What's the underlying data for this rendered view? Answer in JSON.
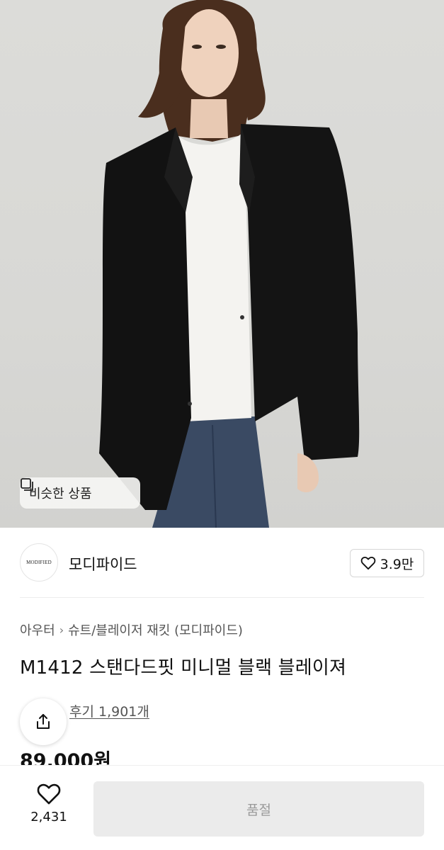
{
  "hero": {
    "similar_label": "비슷한 상품"
  },
  "brand": {
    "logo_text": "MODIFIED",
    "name": "모디파이드",
    "like_count": "3.9만"
  },
  "breadcrumb": {
    "items": [
      "아우터",
      "슈트/블레이저 재킷 (모디파이드)"
    ]
  },
  "product": {
    "title": "M1412 스탠다드핏 미니멀 블랙 블레이져",
    "reviews_label": "후기 1,901개",
    "price": "89,000원"
  },
  "bottom_bar": {
    "heart_count": "2,431",
    "soldout_label": "품절"
  },
  "colors": {
    "hero_bg": "#d8d8d5",
    "blazer": "#111111",
    "soldout_bg": "#ebebeb",
    "soldout_text": "#9a9a9a"
  }
}
